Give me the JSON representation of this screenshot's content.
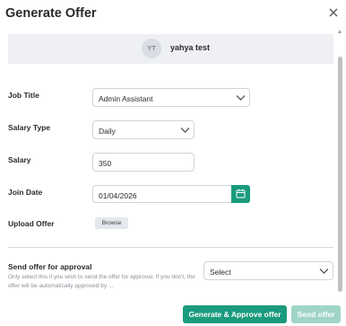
{
  "modal": {
    "title": "Generate Offer",
    "close_icon": "close-icon"
  },
  "candidate": {
    "initials": "YT",
    "name": "yahya test"
  },
  "form": {
    "job_title": {
      "label": "Job Title",
      "value": "Admin Assistant"
    },
    "salary_type": {
      "label": "Salary Type",
      "value": "Daily"
    },
    "salary": {
      "label": "Salary",
      "value": "350"
    },
    "join_date": {
      "label": "Join Date",
      "value": "01/04/2026",
      "icon": "calendar-icon"
    },
    "upload_offer": {
      "label": "Upload Offer",
      "button": "Browse"
    }
  },
  "approval": {
    "title": "Send offer for approval",
    "help": "Only select this if you wish to send the offer for approval. If you don't, the offer will be automatically approved by ...",
    "select_placeholder": "Select"
  },
  "footer": {
    "primary_label": "Generate & Approve offer",
    "secondary_label": "Send offer"
  },
  "colors": {
    "accent": "#1a9b7d",
    "accent_disabled": "#9fd5c7"
  }
}
